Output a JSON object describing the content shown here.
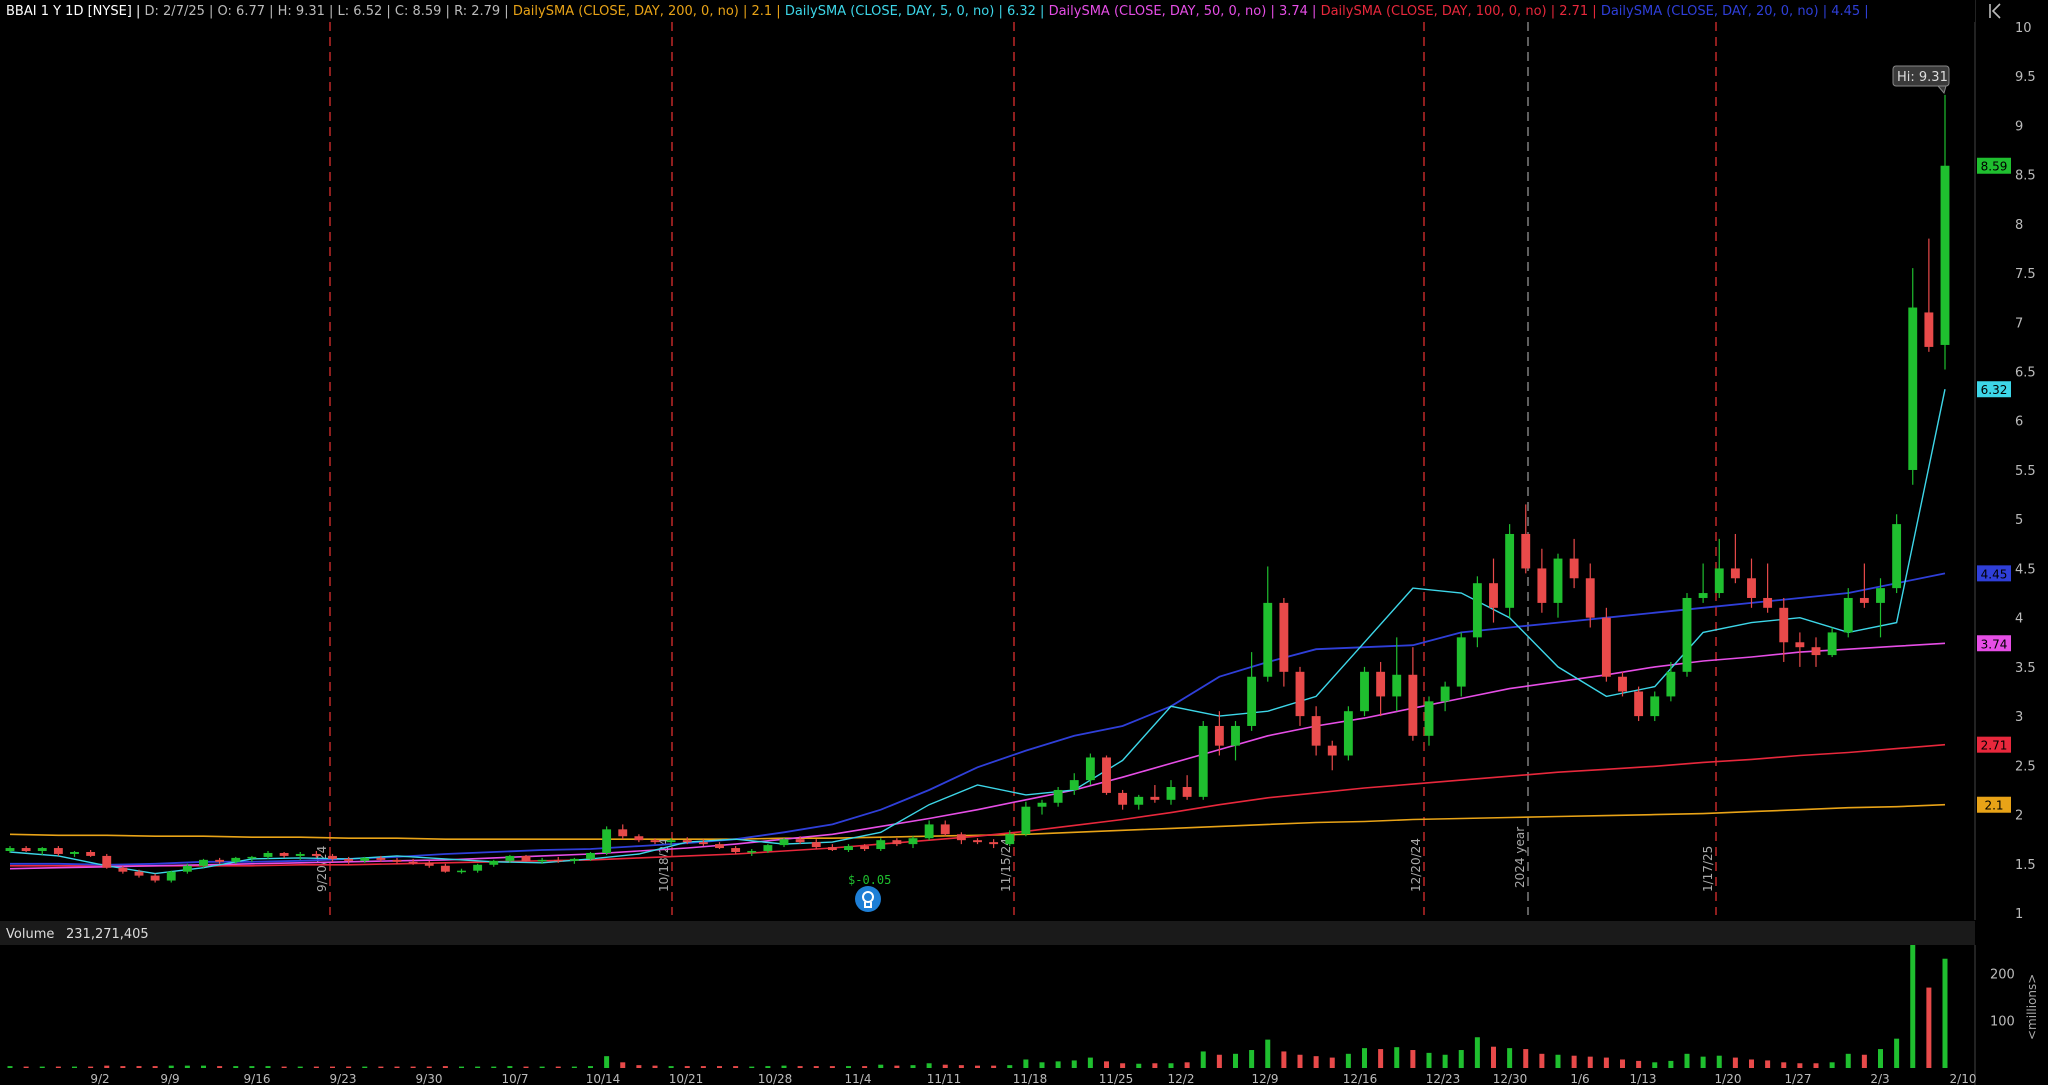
{
  "header": {
    "symbol": "BBAI 1 Y 1D [NYSE]",
    "fields": [
      "D: 2/7/25",
      "O: 6.77",
      "H: 9.31",
      "L: 6.52",
      "C: 8.59",
      "R: 2.79"
    ],
    "studies": [
      {
        "label": "DailySMA (CLOSE, DAY, 200, 0, no)",
        "value": "2.1",
        "color": "#e8a317"
      },
      {
        "label": "DailySMA (CLOSE, DAY, 5, 0, no)",
        "value": "6.32",
        "color": "#3dd6e8"
      },
      {
        "label": "DailySMA (CLOSE, DAY, 50, 0, no)",
        "value": "3.74",
        "color": "#e64ee6"
      },
      {
        "label": "DailySMA (CLOSE, DAY, 100, 0, no)",
        "value": "2.71",
        "color": "#e8283c"
      },
      {
        "label": "DailySMA (CLOSE, DAY, 20, 0, no)",
        "value": "4.45",
        "color": "#2f3fd9"
      }
    ],
    "collapse_icon": "chevron-collapse-icon"
  },
  "volume_panel": {
    "label": "Volume",
    "value": "231,271,405",
    "unit_label": "<millions>"
  },
  "hi_label": "Hi: 9.31",
  "earnings_label": "$-0.05",
  "earnings_icon": "earnings-bulb-icon",
  "colors": {
    "up": "#1fbf2f",
    "down": "#e84a4a",
    "grid": "#cc2b2b",
    "year_line": "#888888"
  },
  "chart_data": {
    "type": "candlestick",
    "y_ticks": [
      1,
      1.5,
      2,
      2.5,
      3,
      3.5,
      4,
      4.5,
      5,
      5.5,
      6,
      6.5,
      7,
      7.5,
      8,
      8.5,
      9,
      9.5,
      10
    ],
    "y_tick_labels": [
      "1",
      "1.5",
      "2",
      "2.5",
      "3",
      "3.5",
      "4",
      "4.5",
      "5",
      "5.5",
      "6",
      "6.5",
      "7",
      "7.5",
      "8",
      "8.5",
      "9",
      "9.5",
      "10"
    ],
    "ylim": [
      0.98,
      10.05
    ],
    "volume_ticks": [
      100,
      200
    ],
    "volume_ylim": [
      0,
      260
    ],
    "x_tick_labels": [
      "9/2",
      "9/9",
      "9/16",
      "9/23",
      "9/30",
      "10/7",
      "10/14",
      "10/21",
      "10/28",
      "11/4",
      "11/11",
      "11/18",
      "11/25",
      "12/2",
      "12/9",
      "12/16",
      "12/23",
      "12/30",
      "1/6",
      "1/13",
      "1/20",
      "1/27",
      "2/3",
      "2/10"
    ],
    "vertical_markers": [
      "9/20/24",
      "10/18/24",
      "11/15/24",
      "12/20/24",
      "2024 year",
      "1/17/25"
    ],
    "price_badges": [
      {
        "label": "8.59",
        "value": 8.59,
        "color": "#1fbf2f"
      },
      {
        "label": "6.32",
        "value": 6.32,
        "color": "#3dd6e8"
      },
      {
        "label": "4.45",
        "value": 4.45,
        "color": "#2f3fd9"
      },
      {
        "label": "3.74",
        "value": 3.74,
        "color": "#e64ee6"
      },
      {
        "label": "2.71",
        "value": 2.71,
        "color": "#e8283c"
      },
      {
        "label": "2.1",
        "value": 2.1,
        "color": "#e8a317"
      }
    ],
    "candles": [
      [
        1.63,
        1.68,
        1.61,
        1.66,
        4
      ],
      [
        1.66,
        1.68,
        1.62,
        1.63,
        3
      ],
      [
        1.63,
        1.67,
        1.59,
        1.66,
        3
      ],
      [
        1.66,
        1.68,
        1.58,
        1.6,
        3
      ],
      [
        1.6,
        1.63,
        1.57,
        1.62,
        3
      ],
      [
        1.62,
        1.64,
        1.57,
        1.58,
        3
      ],
      [
        1.58,
        1.6,
        1.45,
        1.46,
        5
      ],
      [
        1.46,
        1.48,
        1.4,
        1.42,
        4
      ],
      [
        1.42,
        1.44,
        1.36,
        1.38,
        4
      ],
      [
        1.38,
        1.4,
        1.31,
        1.33,
        4
      ],
      [
        1.33,
        1.43,
        1.31,
        1.42,
        5
      ],
      [
        1.42,
        1.5,
        1.4,
        1.48,
        5
      ],
      [
        1.48,
        1.55,
        1.46,
        1.54,
        5
      ],
      [
        1.54,
        1.56,
        1.5,
        1.52,
        4
      ],
      [
        1.52,
        1.57,
        1.5,
        1.56,
        4
      ],
      [
        1.56,
        1.58,
        1.52,
        1.57,
        4
      ],
      [
        1.57,
        1.63,
        1.55,
        1.61,
        4
      ],
      [
        1.61,
        1.62,
        1.56,
        1.58,
        3
      ],
      [
        1.58,
        1.62,
        1.54,
        1.6,
        3
      ],
      [
        1.6,
        1.63,
        1.56,
        1.58,
        3
      ],
      [
        1.58,
        1.6,
        1.52,
        1.55,
        3
      ],
      [
        1.55,
        1.57,
        1.5,
        1.53,
        3
      ],
      [
        1.53,
        1.57,
        1.51,
        1.56,
        3
      ],
      [
        1.56,
        1.58,
        1.52,
        1.54,
        3
      ],
      [
        1.54,
        1.56,
        1.5,
        1.52,
        3
      ],
      [
        1.52,
        1.55,
        1.49,
        1.51,
        3
      ],
      [
        1.51,
        1.53,
        1.46,
        1.48,
        3
      ],
      [
        1.48,
        1.5,
        1.41,
        1.42,
        4
      ],
      [
        1.42,
        1.45,
        1.4,
        1.43,
        3
      ],
      [
        1.43,
        1.5,
        1.41,
        1.49,
        3
      ],
      [
        1.49,
        1.54,
        1.47,
        1.53,
        3
      ],
      [
        1.53,
        1.59,
        1.51,
        1.58,
        4
      ],
      [
        1.58,
        1.59,
        1.52,
        1.53,
        3
      ],
      [
        1.53,
        1.56,
        1.5,
        1.54,
        3
      ],
      [
        1.54,
        1.57,
        1.51,
        1.53,
        3
      ],
      [
        1.53,
        1.56,
        1.5,
        1.55,
        3
      ],
      [
        1.55,
        1.62,
        1.53,
        1.61,
        4
      ],
      [
        1.61,
        1.88,
        1.59,
        1.85,
        25
      ],
      [
        1.85,
        1.9,
        1.75,
        1.78,
        12
      ],
      [
        1.78,
        1.8,
        1.72,
        1.74,
        6
      ],
      [
        1.74,
        1.76,
        1.7,
        1.72,
        5
      ],
      [
        1.72,
        1.76,
        1.69,
        1.74,
        4
      ],
      [
        1.74,
        1.77,
        1.7,
        1.72,
        4
      ],
      [
        1.72,
        1.75,
        1.68,
        1.7,
        4
      ],
      [
        1.7,
        1.72,
        1.65,
        1.66,
        4
      ],
      [
        1.66,
        1.68,
        1.6,
        1.62,
        4
      ],
      [
        1.62,
        1.65,
        1.58,
        1.63,
        3
      ],
      [
        1.63,
        1.7,
        1.61,
        1.69,
        4
      ],
      [
        1.69,
        1.76,
        1.67,
        1.75,
        5
      ],
      [
        1.75,
        1.78,
        1.7,
        1.72,
        4
      ],
      [
        1.72,
        1.75,
        1.65,
        1.67,
        4
      ],
      [
        1.67,
        1.7,
        1.63,
        1.64,
        4
      ],
      [
        1.64,
        1.7,
        1.62,
        1.68,
        4
      ],
      [
        1.68,
        1.7,
        1.63,
        1.65,
        4
      ],
      [
        1.65,
        1.76,
        1.63,
        1.74,
        7
      ],
      [
        1.74,
        1.76,
        1.68,
        1.7,
        5
      ],
      [
        1.7,
        1.78,
        1.66,
        1.76,
        6
      ],
      [
        1.76,
        1.94,
        1.74,
        1.9,
        10
      ],
      [
        1.9,
        1.94,
        1.78,
        1.8,
        7
      ],
      [
        1.8,
        1.82,
        1.7,
        1.74,
        6
      ],
      [
        1.74,
        1.76,
        1.7,
        1.72,
        5
      ],
      [
        1.72,
        1.75,
        1.66,
        1.7,
        5
      ],
      [
        1.7,
        1.84,
        1.68,
        1.8,
        6
      ],
      [
        1.8,
        2.13,
        1.78,
        2.08,
        18
      ],
      [
        2.08,
        2.15,
        2.0,
        2.12,
        12
      ],
      [
        2.12,
        2.28,
        2.08,
        2.25,
        14
      ],
      [
        2.25,
        2.42,
        2.2,
        2.35,
        16
      ],
      [
        2.35,
        2.62,
        2.3,
        2.58,
        22
      ],
      [
        2.58,
        2.6,
        2.2,
        2.22,
        14
      ],
      [
        2.22,
        2.25,
        2.05,
        2.1,
        10
      ],
      [
        2.1,
        2.2,
        2.05,
        2.18,
        9
      ],
      [
        2.18,
        2.3,
        2.12,
        2.15,
        10
      ],
      [
        2.15,
        2.35,
        2.1,
        2.28,
        10
      ],
      [
        2.28,
        2.4,
        2.15,
        2.18,
        12
      ],
      [
        2.18,
        2.95,
        2.15,
        2.9,
        35
      ],
      [
        2.9,
        3.05,
        2.6,
        2.7,
        28
      ],
      [
        2.7,
        2.95,
        2.55,
        2.9,
        30
      ],
      [
        2.9,
        3.65,
        2.85,
        3.4,
        38
      ],
      [
        3.4,
        4.52,
        3.35,
        4.15,
        60
      ],
      [
        4.15,
        4.2,
        3.3,
        3.45,
        35
      ],
      [
        3.45,
        3.5,
        2.9,
        3.0,
        28
      ],
      [
        3.0,
        3.1,
        2.6,
        2.7,
        25
      ],
      [
        2.7,
        2.75,
        2.45,
        2.6,
        22
      ],
      [
        2.6,
        3.1,
        2.55,
        3.05,
        30
      ],
      [
        3.05,
        3.5,
        3.0,
        3.45,
        42
      ],
      [
        3.45,
        3.55,
        3.0,
        3.2,
        40
      ],
      [
        3.2,
        3.8,
        3.05,
        3.42,
        44
      ],
      [
        3.42,
        3.7,
        2.75,
        2.8,
        38
      ],
      [
        2.8,
        3.2,
        2.7,
        3.15,
        32
      ],
      [
        3.15,
        3.35,
        3.05,
        3.3,
        28
      ],
      [
        3.3,
        3.85,
        3.2,
        3.8,
        38
      ],
      [
        3.8,
        4.42,
        3.7,
        4.35,
        65
      ],
      [
        4.35,
        4.6,
        3.95,
        4.1,
        45
      ],
      [
        4.1,
        4.95,
        4.0,
        4.85,
        42
      ],
      [
        4.85,
        5.15,
        4.45,
        4.5,
        40
      ],
      [
        4.5,
        4.7,
        4.05,
        4.15,
        30
      ],
      [
        4.15,
        4.65,
        4.0,
        4.6,
        28
      ],
      [
        4.6,
        4.8,
        4.3,
        4.4,
        26
      ],
      [
        4.4,
        4.55,
        3.9,
        4.0,
        24
      ],
      [
        4.0,
        4.1,
        3.35,
        3.4,
        22
      ],
      [
        3.4,
        3.45,
        3.2,
        3.25,
        18
      ],
      [
        3.25,
        3.3,
        2.95,
        3.0,
        15
      ],
      [
        3.0,
        3.25,
        2.95,
        3.2,
        12
      ],
      [
        3.2,
        3.55,
        3.15,
        3.45,
        15
      ],
      [
        3.45,
        4.25,
        3.4,
        4.2,
        30
      ],
      [
        4.2,
        4.55,
        4.15,
        4.25,
        24
      ],
      [
        4.25,
        4.8,
        4.2,
        4.5,
        26
      ],
      [
        4.5,
        4.85,
        4.35,
        4.4,
        22
      ],
      [
        4.4,
        4.6,
        4.1,
        4.2,
        18
      ],
      [
        4.2,
        4.55,
        4.05,
        4.1,
        16
      ],
      [
        4.1,
        4.2,
        3.55,
        3.75,
        12
      ],
      [
        3.75,
        3.85,
        3.5,
        3.7,
        10
      ],
      [
        3.7,
        3.8,
        3.5,
        3.62,
        10
      ],
      [
        3.62,
        3.9,
        3.6,
        3.85,
        12
      ],
      [
        3.85,
        4.3,
        3.8,
        4.2,
        30
      ],
      [
        4.2,
        4.55,
        4.1,
        4.15,
        28
      ],
      [
        4.15,
        4.4,
        3.8,
        4.3,
        40
      ],
      [
        4.3,
        5.05,
        4.25,
        4.95,
        62
      ],
      [
        5.5,
        7.55,
        5.35,
        7.15,
        275
      ],
      [
        7.1,
        7.85,
        6.7,
        6.75,
        170
      ],
      [
        6.77,
        9.31,
        6.52,
        8.59,
        231
      ]
    ],
    "sma5": [
      1.62,
      1.58,
      1.48,
      1.4,
      1.46,
      1.55,
      1.56,
      1.55,
      1.58,
      1.55,
      1.52,
      1.51,
      1.55,
      1.6,
      1.72,
      1.75,
      1.7,
      1.72,
      1.82,
      2.1,
      2.3,
      2.2,
      2.25,
      2.55,
      3.1,
      3.0,
      3.05,
      3.2,
      3.75,
      4.3,
      4.25,
      4.0,
      3.5,
      3.2,
      3.3,
      3.85,
      3.95,
      4.0,
      3.85,
      3.95,
      6.32
    ],
    "sma20": [
      1.5,
      1.5,
      1.49,
      1.5,
      1.52,
      1.52,
      1.53,
      1.55,
      1.57,
      1.6,
      1.62,
      1.64,
      1.65,
      1.68,
      1.71,
      1.75,
      1.82,
      1.9,
      2.05,
      2.25,
      2.48,
      2.65,
      2.8,
      2.9,
      3.1,
      3.4,
      3.55,
      3.68,
      3.7,
      3.72,
      3.85,
      3.9,
      3.95,
      4.0,
      4.05,
      4.1,
      4.15,
      4.2,
      4.25,
      4.35,
      4.45
    ],
    "sma50": [
      1.45,
      1.46,
      1.47,
      1.48,
      1.49,
      1.5,
      1.51,
      1.52,
      1.53,
      1.54,
      1.56,
      1.58,
      1.6,
      1.63,
      1.66,
      1.7,
      1.75,
      1.8,
      1.88,
      1.96,
      2.05,
      2.15,
      2.25,
      2.38,
      2.52,
      2.66,
      2.8,
      2.9,
      2.98,
      3.08,
      3.18,
      3.28,
      3.35,
      3.42,
      3.5,
      3.56,
      3.6,
      3.65,
      3.68,
      3.71,
      3.74
    ],
    "sma100": [
      1.48,
      1.48,
      1.48,
      1.48,
      1.48,
      1.48,
      1.49,
      1.49,
      1.5,
      1.51,
      1.52,
      1.53,
      1.54,
      1.56,
      1.58,
      1.6,
      1.63,
      1.66,
      1.7,
      1.74,
      1.78,
      1.83,
      1.89,
      1.95,
      2.02,
      2.1,
      2.17,
      2.22,
      2.27,
      2.31,
      2.35,
      2.39,
      2.43,
      2.46,
      2.49,
      2.53,
      2.56,
      2.6,
      2.63,
      2.67,
      2.71
    ],
    "sma200": [
      1.8,
      1.79,
      1.79,
      1.78,
      1.78,
      1.77,
      1.77,
      1.76,
      1.76,
      1.75,
      1.75,
      1.75,
      1.75,
      1.75,
      1.75,
      1.75,
      1.76,
      1.76,
      1.77,
      1.78,
      1.79,
      1.8,
      1.82,
      1.84,
      1.86,
      1.88,
      1.9,
      1.92,
      1.93,
      1.95,
      1.96,
      1.97,
      1.98,
      1.99,
      2.0,
      2.01,
      2.03,
      2.05,
      2.07,
      2.08,
      2.1
    ]
  }
}
